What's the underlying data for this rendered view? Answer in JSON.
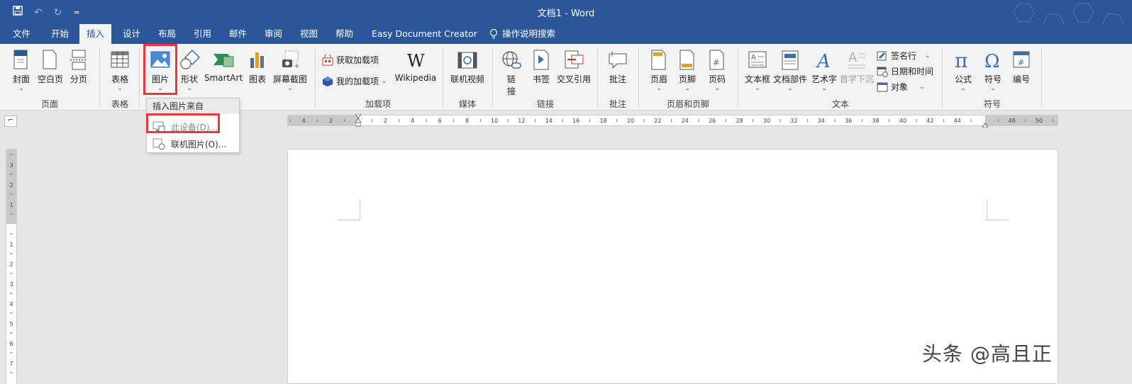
{
  "window": {
    "title": "文档1  -  Word"
  },
  "qat": {
    "save_icon": "save-icon",
    "undo": "↶",
    "redo": "↻",
    "customize": "="
  },
  "tabs": [
    "文件",
    "开始",
    "插入",
    "设计",
    "布局",
    "引用",
    "邮件",
    "审阅",
    "视图",
    "帮助",
    "Easy Document Creator"
  ],
  "tell_me": "操作说明搜索",
  "ribbon": {
    "pages": {
      "label": "页面",
      "cover": "封面",
      "blank": "空白页",
      "break": "分页"
    },
    "tables": {
      "label": "表格",
      "table": "表格"
    },
    "illustrations": {
      "picture": "图片",
      "shapes": "形状",
      "smartart": "SmartArt",
      "chart": "图表",
      "screenshot": "屏幕截图"
    },
    "addins": {
      "label": "加载项",
      "get": "获取加载项",
      "my": "我的加载项",
      "wikipedia": "Wikipedia"
    },
    "media": {
      "label": "媒体",
      "video": "联机视频"
    },
    "links": {
      "label": "链接",
      "link_top": "链",
      "link_bottom": "接",
      "bookmark": "书签",
      "crossref": "交叉引用"
    },
    "comments": {
      "label": "批注",
      "comment": "批注"
    },
    "header_footer": {
      "label": "页眉和页脚",
      "header": "页眉",
      "footer": "页脚",
      "page_number": "页码"
    },
    "text": {
      "label": "文本",
      "textbox": "文本框",
      "quickparts": "文档部件",
      "wordart": "艺术字",
      "dropcap": "首字下沉",
      "signature": "签名行",
      "datetime": "日期和时间",
      "object": "对象"
    },
    "symbols": {
      "label": "符号",
      "equation": "公式",
      "symbol": "符号",
      "number": "编号"
    }
  },
  "dropdown": {
    "header": "插入图片来自",
    "items": [
      {
        "label": "此设备(D)..."
      },
      {
        "label": "联机图片(O)..."
      }
    ]
  },
  "ruler": {
    "h_left": [
      "4",
      "2"
    ],
    "h_right": [
      "2",
      "4",
      "6",
      "8",
      "10",
      "12",
      "14",
      "16",
      "18",
      "20",
      "22",
      "24",
      "26",
      "28",
      "30",
      "32",
      "34",
      "36",
      "38",
      "40",
      "42",
      "44",
      "48",
      "50"
    ],
    "v_top": [
      "3",
      "2",
      "1"
    ],
    "v_bottom": [
      "1",
      "2",
      "3",
      "4",
      "5",
      "6",
      "7",
      "8"
    ]
  },
  "watermark": "头条 @高且正",
  "colors": {
    "accent": "#2b579a",
    "highlight": "#e8383d"
  }
}
